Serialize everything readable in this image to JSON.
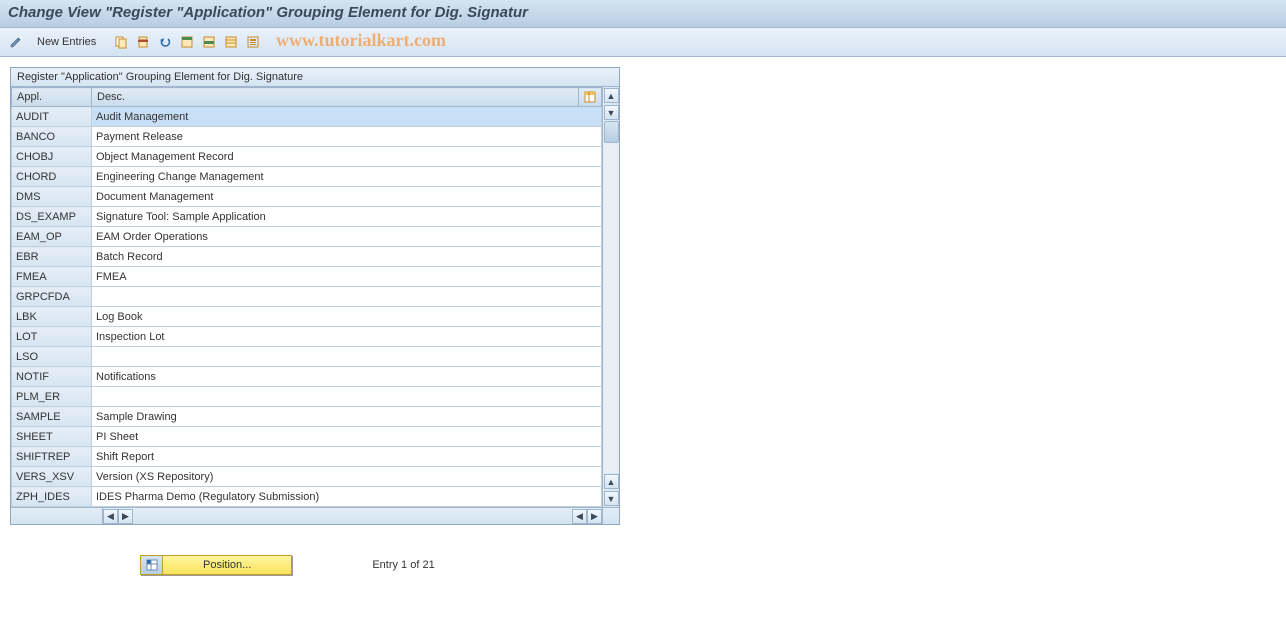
{
  "title": "Change View \"Register \"Application\" Grouping Element for Dig. Signatur",
  "toolbar": {
    "new_entries_label": "New Entries"
  },
  "watermark": "www.tutorialkart.com",
  "panel": {
    "title": "Register \"Application\" Grouping Element for Dig. Signature",
    "columns": {
      "code": "Appl.",
      "desc": "Desc."
    }
  },
  "rows": [
    {
      "code": "AUDIT",
      "desc": "Audit Management",
      "selected": true
    },
    {
      "code": "BANCO",
      "desc": "Payment Release"
    },
    {
      "code": "CHOBJ",
      "desc": "Object Management Record"
    },
    {
      "code": "CHORD",
      "desc": "Engineering Change Management"
    },
    {
      "code": "DMS",
      "desc": "Document Management"
    },
    {
      "code": "DS_EXAMP",
      "desc": "Signature Tool: Sample Application"
    },
    {
      "code": "EAM_OP",
      "desc": "EAM Order Operations"
    },
    {
      "code": "EBR",
      "desc": "Batch Record"
    },
    {
      "code": "FMEA",
      "desc": "FMEA"
    },
    {
      "code": "GRPCFDA",
      "desc": ""
    },
    {
      "code": "LBK",
      "desc": "Log Book"
    },
    {
      "code": "LOT",
      "desc": "Inspection Lot"
    },
    {
      "code": "LSO",
      "desc": ""
    },
    {
      "code": "NOTIF",
      "desc": "Notifications"
    },
    {
      "code": "PLM_ER",
      "desc": ""
    },
    {
      "code": "SAMPLE",
      "desc": "Sample Drawing"
    },
    {
      "code": "SHEET",
      "desc": "PI Sheet"
    },
    {
      "code": "SHIFTREP",
      "desc": "Shift Report"
    },
    {
      "code": "VERS_XSV",
      "desc": "Version (XS Repository)"
    },
    {
      "code": "ZPH_IDES",
      "desc": "IDES Pharma Demo (Regulatory Submission)"
    }
  ],
  "footer": {
    "position_label": "Position...",
    "entry_status": "Entry 1 of 21"
  }
}
